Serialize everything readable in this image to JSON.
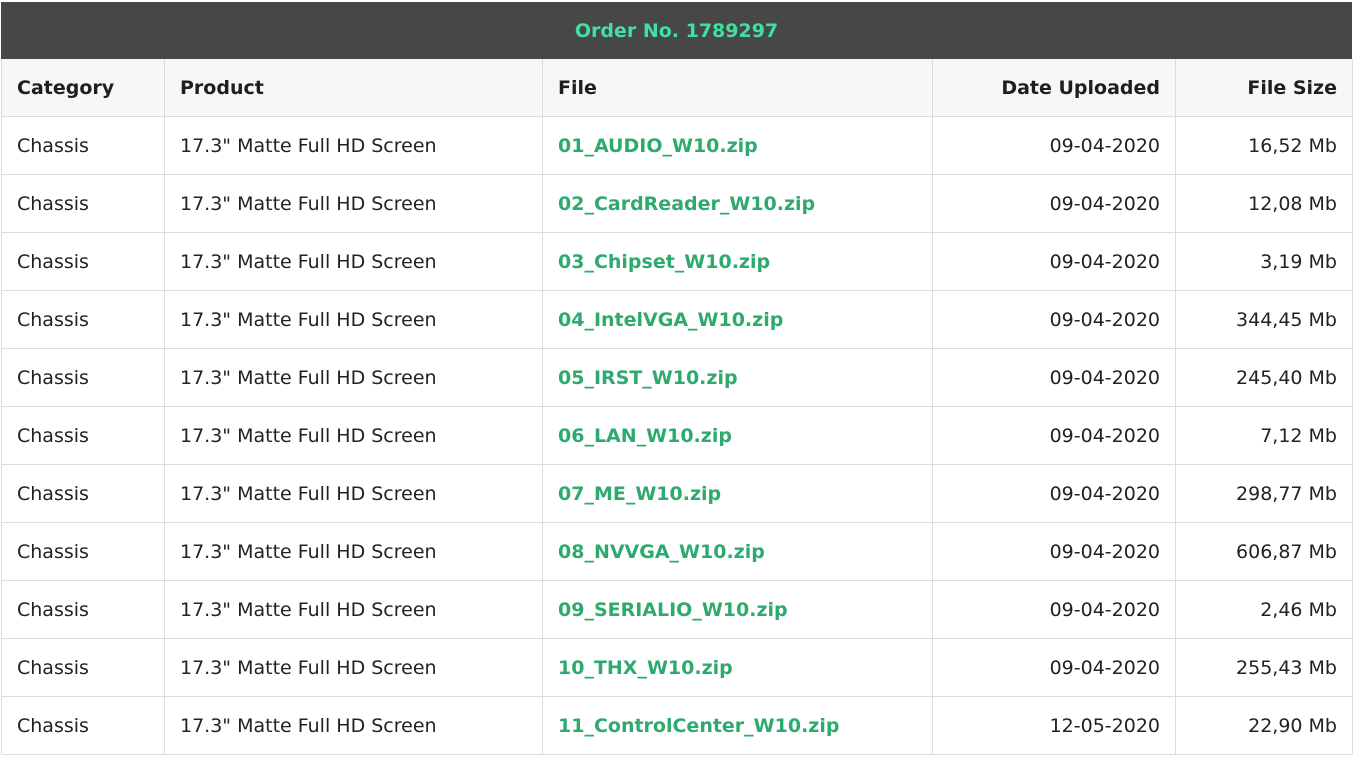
{
  "order": {
    "title": "Order No. 1789297"
  },
  "colors": {
    "header_bg": "#474747",
    "header_text": "#3fe0a0",
    "link": "#2eaa6e"
  },
  "table": {
    "columns": {
      "category": "Category",
      "product": "Product",
      "file": "File",
      "date": "Date Uploaded",
      "size": "File Size"
    },
    "rows": [
      {
        "category": "Chassis",
        "product": "17.3\" Matte Full HD Screen",
        "file": "01_AUDIO_W10.zip",
        "date": "09-04-2020",
        "size": "16,52 Mb"
      },
      {
        "category": "Chassis",
        "product": "17.3\" Matte Full HD Screen",
        "file": "02_CardReader_W10.zip",
        "date": "09-04-2020",
        "size": "12,08 Mb"
      },
      {
        "category": "Chassis",
        "product": "17.3\" Matte Full HD Screen",
        "file": "03_Chipset_W10.zip",
        "date": "09-04-2020",
        "size": "3,19 Mb"
      },
      {
        "category": "Chassis",
        "product": "17.3\" Matte Full HD Screen",
        "file": "04_IntelVGA_W10.zip",
        "date": "09-04-2020",
        "size": "344,45 Mb"
      },
      {
        "category": "Chassis",
        "product": "17.3\" Matte Full HD Screen",
        "file": "05_IRST_W10.zip",
        "date": "09-04-2020",
        "size": "245,40 Mb"
      },
      {
        "category": "Chassis",
        "product": "17.3\" Matte Full HD Screen",
        "file": "06_LAN_W10.zip",
        "date": "09-04-2020",
        "size": "7,12 Mb"
      },
      {
        "category": "Chassis",
        "product": "17.3\" Matte Full HD Screen",
        "file": "07_ME_W10.zip",
        "date": "09-04-2020",
        "size": "298,77 Mb"
      },
      {
        "category": "Chassis",
        "product": "17.3\" Matte Full HD Screen",
        "file": "08_NVVGA_W10.zip",
        "date": "09-04-2020",
        "size": "606,87 Mb"
      },
      {
        "category": "Chassis",
        "product": "17.3\" Matte Full HD Screen",
        "file": "09_SERIALIO_W10.zip",
        "date": "09-04-2020",
        "size": "2,46 Mb"
      },
      {
        "category": "Chassis",
        "product": "17.3\" Matte Full HD Screen",
        "file": "10_THX_W10.zip",
        "date": "09-04-2020",
        "size": "255,43 Mb"
      },
      {
        "category": "Chassis",
        "product": "17.3\" Matte Full HD Screen",
        "file": "11_ControlCenter_W10.zip",
        "date": "12-05-2020",
        "size": "22,90 Mb"
      }
    ]
  }
}
